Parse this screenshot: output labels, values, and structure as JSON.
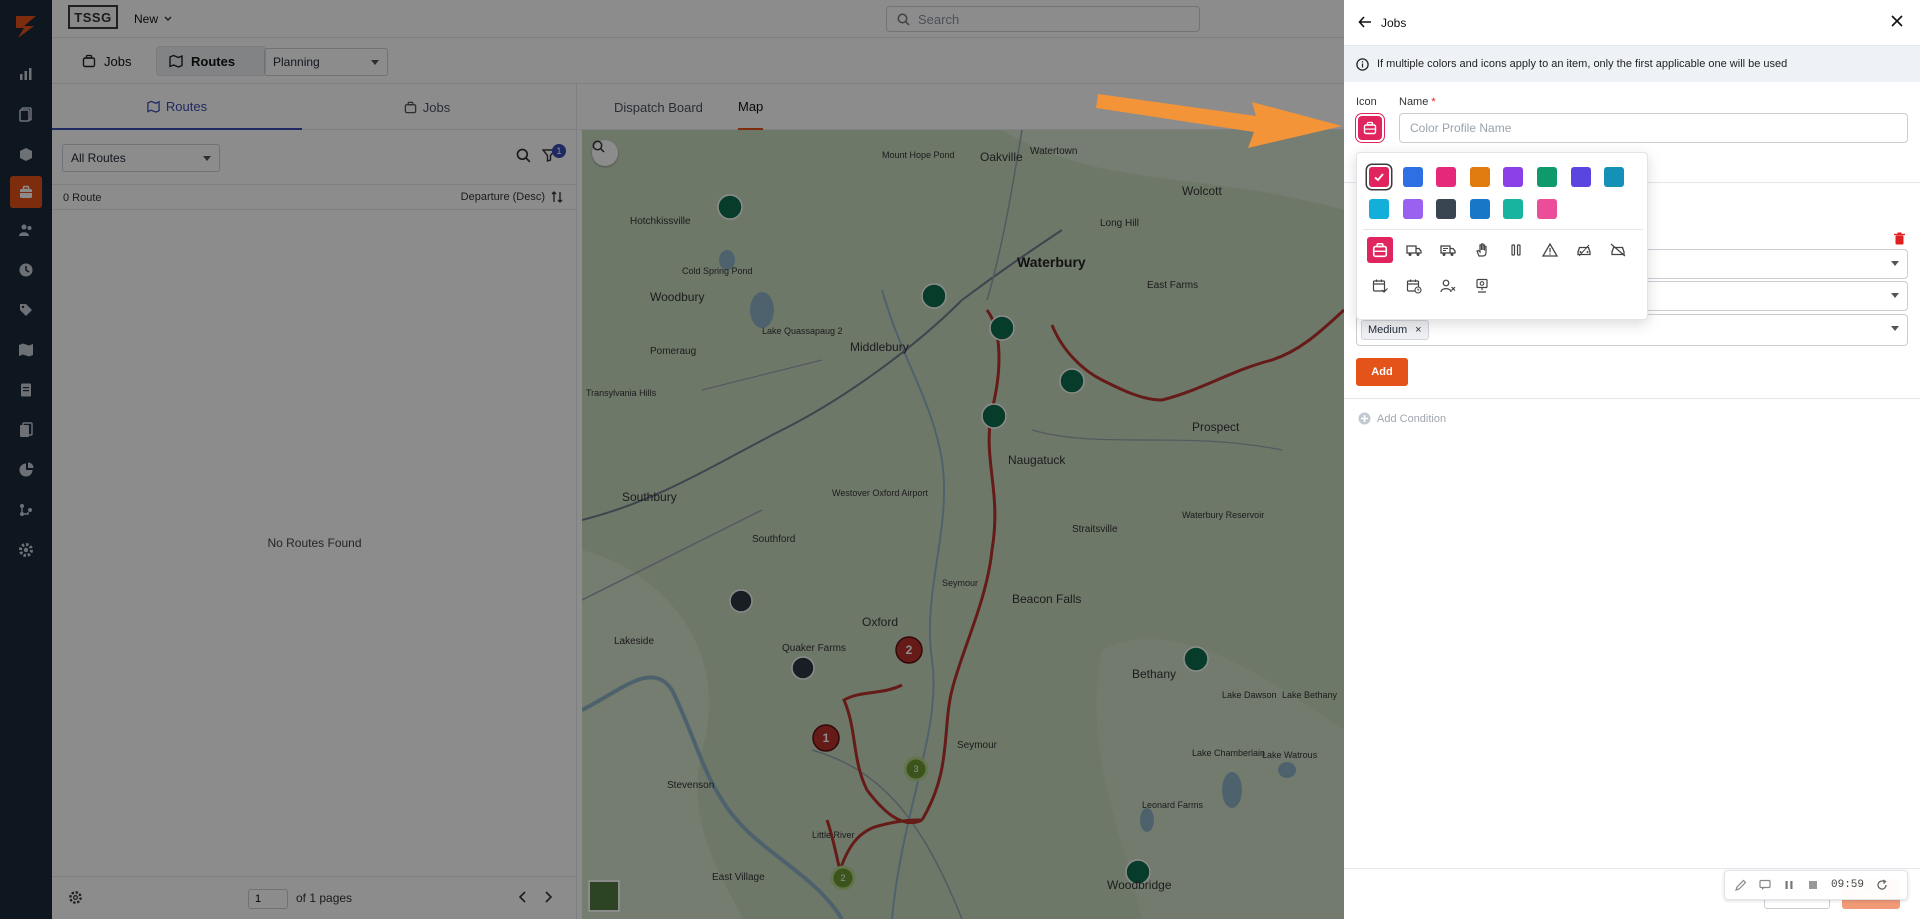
{
  "topbar": {
    "brand": "TSSG",
    "new_label": "New",
    "search_placeholder": "Search"
  },
  "toolbar": {
    "jobs_label": "Jobs",
    "routes_label": "Routes",
    "planning_value": "Planning"
  },
  "routes_panel": {
    "tab_routes": "Routes",
    "tab_jobs": "Jobs",
    "filter_value": "All Routes",
    "filter_badge": "1",
    "route_count": "0 Route",
    "sort_label": "Departure (Desc)",
    "empty_message": "No Routes Found",
    "page_value": "1",
    "page_of": "of 1 pages"
  },
  "map_area": {
    "tab_dispatch": "Dispatch Board",
    "tab_map": "Map",
    "towns": [
      "Oakville",
      "Watertown",
      "Wolcott",
      "Hotchkissville",
      "Waterbury",
      "Woodbury",
      "Long Hill",
      "East Farms",
      "Lake Quassapaug 2",
      "Middlebury",
      "Pomeraug",
      "Transylvania Hills",
      "Prospect",
      "Naugatuck",
      "Southbury",
      "Westover Oxford Airport",
      "Southford",
      "Straitsville",
      "Seymour",
      "Oxford",
      "Beacon Falls",
      "Lakeside",
      "Quaker Farms",
      "Bethany",
      "Stevenson",
      "Seymour",
      "Woodbridge",
      "East Village",
      "Lake Chamberlain",
      "Lake Watrous",
      "Lake Dawson",
      "Lake Bethany",
      "Mount Hope Pond",
      "Waterbury Reservoir",
      "Leonard Farms",
      "Cold Spring Pond",
      "Little River"
    ],
    "route_markers": [
      "1",
      "2"
    ],
    "cluster_markers": [
      "3",
      "2"
    ]
  },
  "drawer": {
    "title": "Jobs",
    "notice": "If multiple colors and icons apply to an item, only the first applicable one will be used",
    "icon_label": "Icon",
    "name_label": "Name",
    "name_required": "*",
    "name_placeholder": "Color Profile Name",
    "chip_medium": "Medium",
    "chip_remove": "×",
    "add_label": "Add",
    "add_condition_label": "Add Condition",
    "cancel_label": "Cancel",
    "save_label": "Save"
  },
  "picker": {
    "colors": [
      "#e0245e",
      "#2f6fe4",
      "#e6287a",
      "#e07b10",
      "#8b3fe6",
      "#0e9a6a",
      "#5a45e0",
      "#1591b8",
      "#12b0d8",
      "#9a60f0",
      "#3a4552",
      "#1877c6",
      "#18b4a0",
      "#ec4d9a"
    ],
    "selected_color_index": 0,
    "icons": [
      "briefcase-icon",
      "truck-icon",
      "delivery-truck-icon",
      "hand-icon",
      "pause-icon",
      "warning-icon",
      "car-icon",
      "no-car-icon",
      "calendar-check-icon",
      "calendar-clock-icon",
      "user-x-icon",
      "pin-icon"
    ],
    "selected_icon_index": 0
  },
  "recorder": {
    "time": "09:59"
  },
  "colors": {
    "accent": "#e4531a",
    "primary": "#3b4db3",
    "rail": "#1b2a3a",
    "route": "#b8322a",
    "marker": "#0d6d4f"
  }
}
